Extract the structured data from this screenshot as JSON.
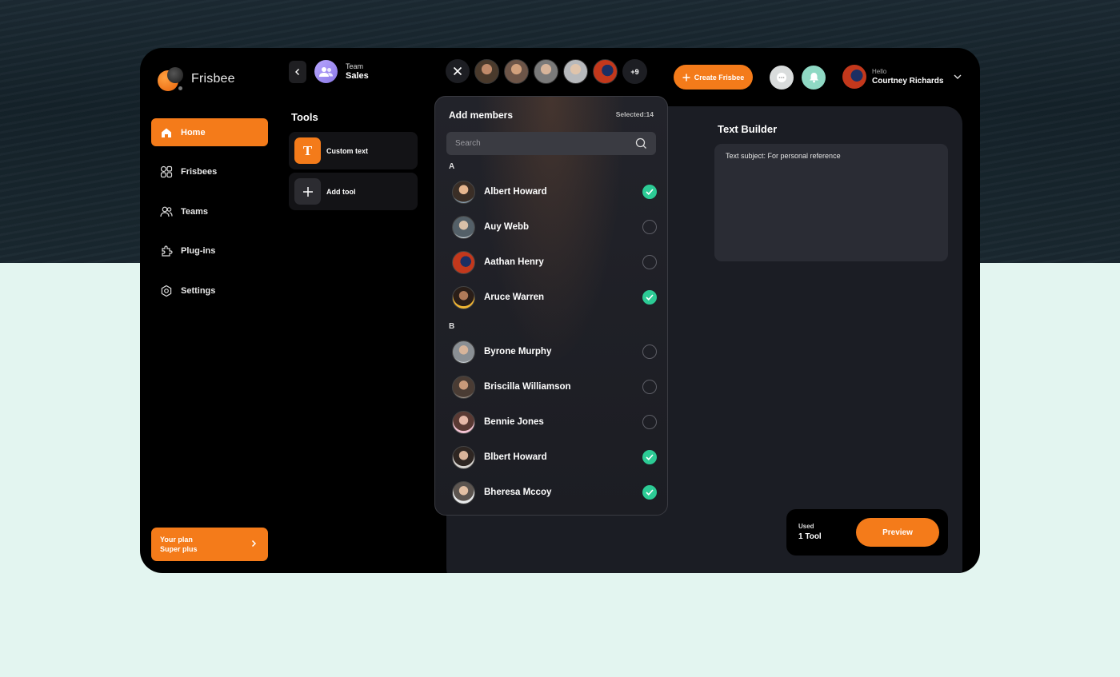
{
  "app": {
    "name": "Frisbee"
  },
  "colors": {
    "accent": "#f47b1a",
    "check": "#2ccb95",
    "background": "#000000",
    "panel": "#1b1d24"
  },
  "sidebar": {
    "items": [
      {
        "label": "Home",
        "icon": "home-icon",
        "active": true
      },
      {
        "label": "Frisbees",
        "icon": "grid-icon",
        "active": false
      },
      {
        "label": "Teams",
        "icon": "users-icon",
        "active": false
      },
      {
        "label": "Plug-ins",
        "icon": "puzzle-icon",
        "active": false
      },
      {
        "label": "Settings",
        "icon": "gear-icon",
        "active": false
      }
    ],
    "plan": {
      "line1": "Your plan",
      "line2": "Super plus"
    }
  },
  "team": {
    "label": "Team",
    "name": "Sales"
  },
  "tools": {
    "title": "Tools",
    "items": [
      {
        "label": "Custom text",
        "icon_glyph": "T"
      },
      {
        "label": "Add tool",
        "icon_glyph": "+"
      }
    ]
  },
  "topbar": {
    "more_count": "+9",
    "create_label": "Create Frisbee",
    "user": {
      "greeting": "Hello",
      "name": "Courtney Richards"
    }
  },
  "text_builder": {
    "title": "Text Builder",
    "subject": "Text subject: For personal reference"
  },
  "usage": {
    "label": "Used",
    "value": "1 Tool",
    "preview_label": "Preview"
  },
  "add_members": {
    "title": "Add members",
    "selected": "Selected:14",
    "search_placeholder": "Search",
    "groups": [
      {
        "letter": "A",
        "members": [
          {
            "name": "Albert Howard",
            "checked": true
          },
          {
            "name": "Auy Webb",
            "checked": false
          },
          {
            "name": "Aathan Henry",
            "checked": false
          },
          {
            "name": "Aruce Warren",
            "checked": true
          }
        ]
      },
      {
        "letter": "B",
        "members": [
          {
            "name": "Byrone Murphy",
            "checked": false
          },
          {
            "name": "Briscilla Williamson",
            "checked": false
          },
          {
            "name": "Bennie Jones",
            "checked": false
          },
          {
            "name": "Blbert Howard",
            "checked": true
          },
          {
            "name": "Bheresa Mccoy",
            "checked": true
          }
        ]
      }
    ]
  }
}
